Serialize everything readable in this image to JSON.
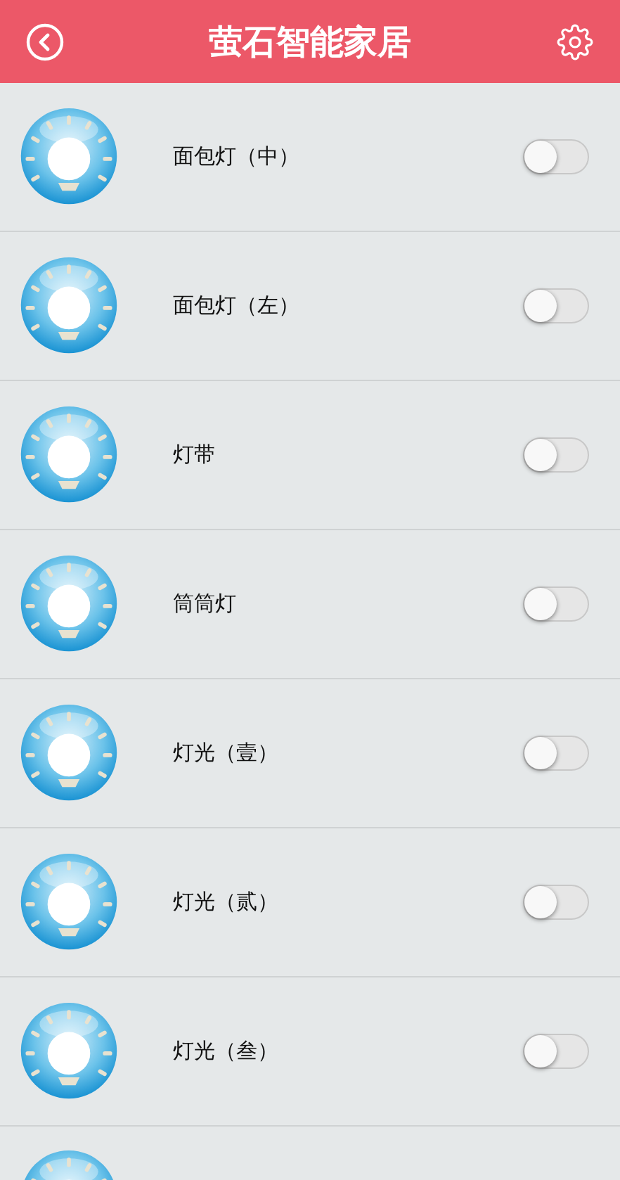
{
  "header": {
    "title": "萤石智能家居"
  },
  "devices": [
    {
      "label": "面包灯（中）",
      "on": false
    },
    {
      "label": "面包灯（左）",
      "on": false
    },
    {
      "label": "灯带",
      "on": false
    },
    {
      "label": "筒筒灯",
      "on": false
    },
    {
      "label": "灯光（壹）",
      "on": false
    },
    {
      "label": "灯光（贰）",
      "on": false
    },
    {
      "label": "灯光（叁）",
      "on": false
    },
    {
      "kind": "partial"
    }
  ]
}
